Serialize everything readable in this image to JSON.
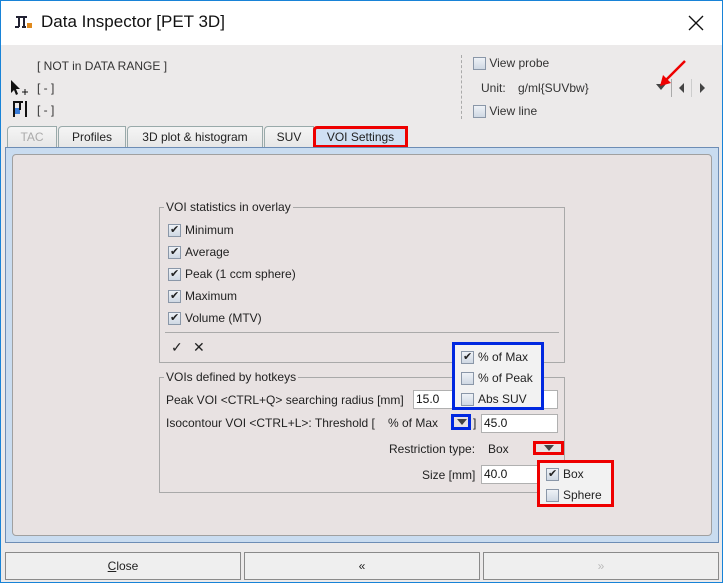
{
  "window": {
    "title": "Data Inspector [PET 3D]",
    "close_icon": "close-icon"
  },
  "info": {
    "range_status": "[ NOT in DATA RANGE ]",
    "cursor_value": "[ - ]",
    "probe_value": "[ - ]"
  },
  "controls": {
    "view_probe_label": "View probe",
    "view_probe_checked": false,
    "unit_label": "Unit:",
    "unit_value": "g/ml{SUVbw}",
    "view_line_label": "View line",
    "view_line_checked": false
  },
  "tabs": [
    {
      "label": "TAC",
      "state": "disabled"
    },
    {
      "label": "Profiles",
      "state": "normal"
    },
    {
      "label": "3D plot & histogram",
      "state": "normal"
    },
    {
      "label": "SUV",
      "state": "normal"
    },
    {
      "label": "VOI Settings",
      "state": "active"
    }
  ],
  "voi_statistics": {
    "title": "VOI statistics in overlay",
    "items": [
      {
        "label": "Minimum",
        "checked": true
      },
      {
        "label": "Average",
        "checked": true
      },
      {
        "label": "Peak (1 ccm sphere)",
        "checked": true
      },
      {
        "label": "Maximum",
        "checked": true
      },
      {
        "label": "Volume (MTV)",
        "checked": true
      }
    ],
    "check_all_symbol": "✓",
    "uncheck_all_symbol": "✕"
  },
  "hotkeys": {
    "title": "VOIs defined by hotkeys",
    "peak_label": "Peak VOI <CTRL+Q> searching radius [mm]",
    "peak_value": "15.0",
    "iso_label": "Isocontour VOI <CTRL+L>:  Threshold [",
    "iso_mode": "% of Max",
    "iso_bracket": "]",
    "iso_value": "45.0",
    "restriction_label": "Restriction type:",
    "restriction_value": "Box",
    "size_label": "Size [mm]",
    "size_value": "40.0"
  },
  "threshold_popup": [
    {
      "label": "% of Max",
      "checked": true
    },
    {
      "label": "% of Peak",
      "checked": false
    },
    {
      "label": "Abs SUV",
      "checked": false
    }
  ],
  "restriction_popup": [
    {
      "label": "Box",
      "checked": true
    },
    {
      "label": "Sphere",
      "checked": false
    }
  ],
  "buttons": {
    "close": "Close",
    "prev": "«",
    "next": "»"
  },
  "colors": {
    "highlight_red": "#e00000",
    "highlight_blue": "#0028e0",
    "active_tab": "#cfe0f3"
  }
}
